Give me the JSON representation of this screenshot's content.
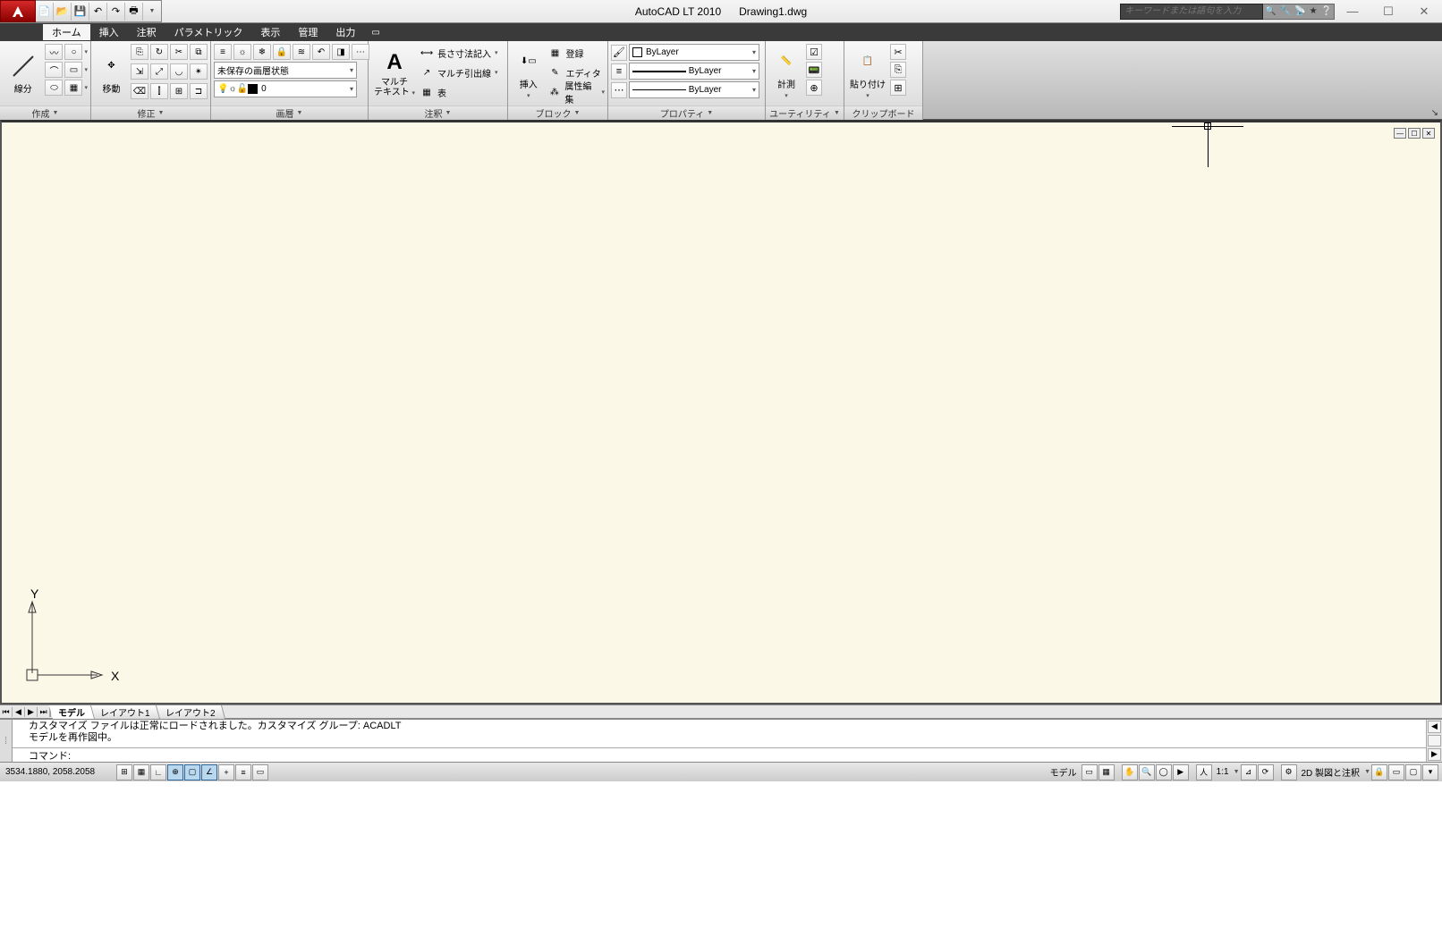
{
  "titlebar": {
    "app_title": "AutoCAD LT 2010",
    "document": "Drawing1.dwg"
  },
  "search": {
    "placeholder": "キーワードまたは語句を入力"
  },
  "menu_tabs": [
    "ホーム",
    "挿入",
    "注釈",
    "パラメトリック",
    "表示",
    "管理",
    "出力"
  ],
  "ribbon": {
    "draw": {
      "line": "線分",
      "title": "作成"
    },
    "modify": {
      "move": "移動",
      "title": "修正"
    },
    "layer": {
      "state": "未保存の画層状態",
      "current": "0",
      "title": "画層"
    },
    "annot": {
      "mtext1": "マルチ",
      "mtext2": "テキスト",
      "dim": "長さ寸法記入",
      "mleader": "マルチ引出線",
      "table": "表",
      "title": "注釈"
    },
    "block": {
      "insert": "挿入",
      "reg": "登録",
      "editor": "エディタ",
      "attedit": "属性編集",
      "title": "ブロック"
    },
    "prop": {
      "color": "ByLayer",
      "lw": "ByLayer",
      "lt": "ByLayer",
      "title": "プロパティ"
    },
    "util": {
      "measure": "計測",
      "title": "ユーティリティ"
    },
    "clip": {
      "paste": "貼り付け",
      "title": "クリップボード"
    }
  },
  "layout_tabs": [
    "モデル",
    "レイアウト1",
    "レイアウト2"
  ],
  "command": {
    "hist1": "カスタマイズ ファイルは正常にロードされました。カスタマイズ グループ: ACADLT",
    "hist2": "モデルを再作図中。",
    "prompt": "コマンド:"
  },
  "status": {
    "coords": "3534.1880, 2058.2058",
    "space": "モデル",
    "scale": "1:1",
    "workspace": "2D 製図と注釈"
  },
  "ucs": {
    "x": "X",
    "y": "Y"
  }
}
